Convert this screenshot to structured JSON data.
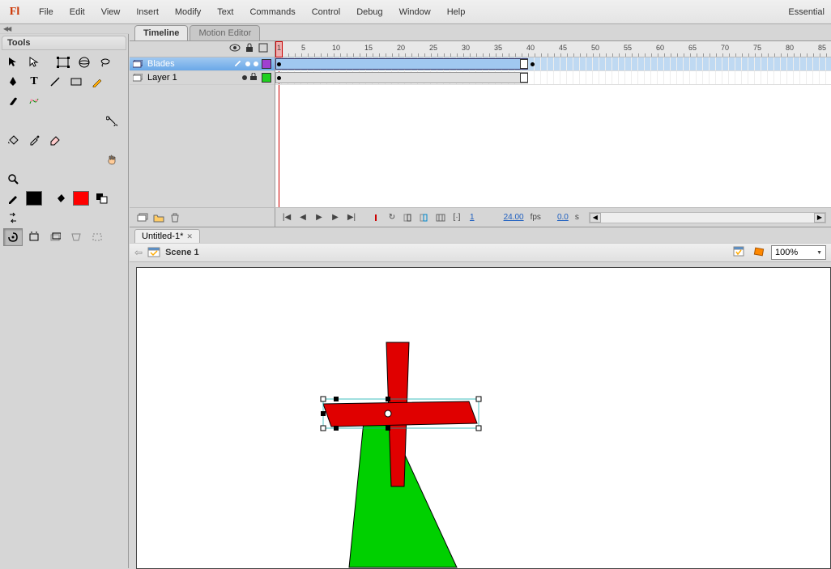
{
  "app": {
    "logo_text": "Fl"
  },
  "menubar": {
    "items": [
      "File",
      "Edit",
      "View",
      "Insert",
      "Modify",
      "Text",
      "Commands",
      "Control",
      "Debug",
      "Window",
      "Help"
    ],
    "right": "Essential"
  },
  "tools_panel": {
    "title": "Tools"
  },
  "timeline": {
    "tabs": {
      "active": "Timeline",
      "inactive": "Motion Editor"
    },
    "ruler_ticks": [
      1,
      5,
      10,
      15,
      20,
      25,
      30,
      35,
      40,
      45,
      50,
      55,
      60,
      65,
      70,
      75,
      80,
      85
    ],
    "layers": [
      {
        "name": "Blades",
        "selected": true,
        "color": "#a040d0",
        "locked": false
      },
      {
        "name": "Layer 1",
        "selected": false,
        "color": "#20d020",
        "locked": true
      }
    ],
    "status": {
      "frame": "1",
      "fps": "24.00",
      "fps_label": "fps",
      "time": "0.0",
      "time_label": "s"
    }
  },
  "document": {
    "tab_label": "Untitled-1*"
  },
  "scene": {
    "name": "Scene 1",
    "zoom": "100%"
  }
}
